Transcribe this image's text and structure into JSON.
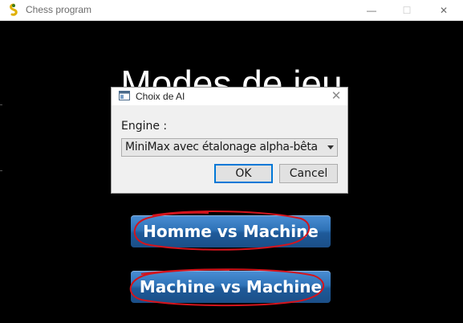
{
  "window": {
    "title": "Chess program",
    "app_icon": "pygame-snake-icon",
    "controls": {
      "minimize": "—",
      "maximize": "☐",
      "close": "✕"
    }
  },
  "main": {
    "heading": "Modes de jeu",
    "buttons": [
      {
        "label": "Homme vs Machine"
      },
      {
        "label": "Machine vs Machine"
      }
    ],
    "scribble_color": "#d4141c",
    "button_color": "#2f73b8"
  },
  "dialog": {
    "title": "Choix de AI",
    "close": "✕",
    "engine_label": "Engine :",
    "engine_selected": "MiniMax avec étalonage alpha-bêta",
    "ok_label": "OK",
    "cancel_label": "Cancel"
  }
}
